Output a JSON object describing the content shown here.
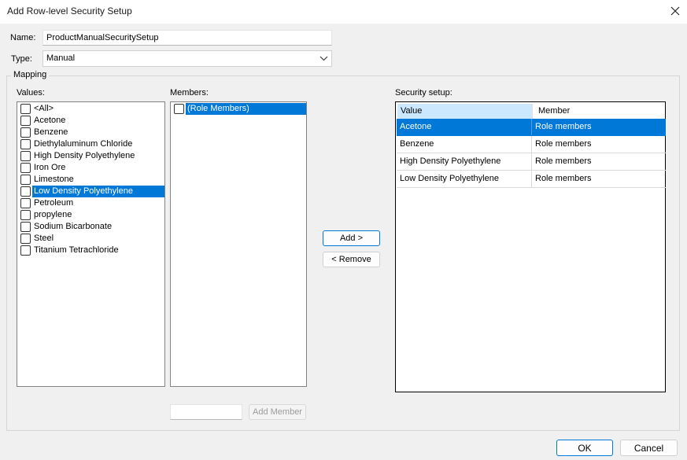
{
  "window": {
    "title": "Add Row-level Security Setup"
  },
  "name_field": {
    "label": "Name:",
    "value": "ProductManualSecuritySetup"
  },
  "type_field": {
    "label": "Type:",
    "value": "Manual"
  },
  "mapping": {
    "title": "Mapping",
    "values_label": "Values:",
    "values": [
      {
        "label": "<All>",
        "checked": false,
        "selected": false
      },
      {
        "label": "Acetone",
        "checked": false,
        "selected": false
      },
      {
        "label": "Benzene",
        "checked": false,
        "selected": false
      },
      {
        "label": "Diethylaluminum Chloride",
        "checked": false,
        "selected": false
      },
      {
        "label": "High Density Polyethylene",
        "checked": false,
        "selected": false
      },
      {
        "label": "Iron Ore",
        "checked": false,
        "selected": false
      },
      {
        "label": "Limestone",
        "checked": false,
        "selected": false
      },
      {
        "label": "Low Density Polyethylene",
        "checked": false,
        "selected": true
      },
      {
        "label": "Petroleum",
        "checked": false,
        "selected": false
      },
      {
        "label": "propylene",
        "checked": false,
        "selected": false
      },
      {
        "label": "Sodium Bicarbonate",
        "checked": false,
        "selected": false
      },
      {
        "label": "Steel",
        "checked": false,
        "selected": false
      },
      {
        "label": "Titanium Tetrachloride",
        "checked": false,
        "selected": false
      }
    ],
    "members_label": "Members:",
    "members": [
      {
        "label": "(Role Members)",
        "checked": false,
        "selected": true
      }
    ],
    "add_member_input": {
      "value": ""
    },
    "add_member_button": "Add Member",
    "add_button": "Add >",
    "remove_button": "< Remove",
    "security_setup_label": "Security setup:",
    "columns": [
      "Value",
      "Member"
    ],
    "rows": [
      {
        "value": "Acetone",
        "member": "Role members",
        "selected": true
      },
      {
        "value": "Benzene",
        "member": "Role members",
        "selected": false
      },
      {
        "value": "High Density Polyethylene",
        "member": "Role members",
        "selected": false
      },
      {
        "value": "Low Density Polyethylene",
        "member": "Role members",
        "selected": false
      }
    ]
  },
  "footer": {
    "ok": "OK",
    "cancel": "Cancel"
  },
  "colors": {
    "selection": "#0078d7",
    "header_highlight": "#cce8ff"
  },
  "icons": {
    "close": "close-icon",
    "combo": "chevron-down-icon"
  }
}
